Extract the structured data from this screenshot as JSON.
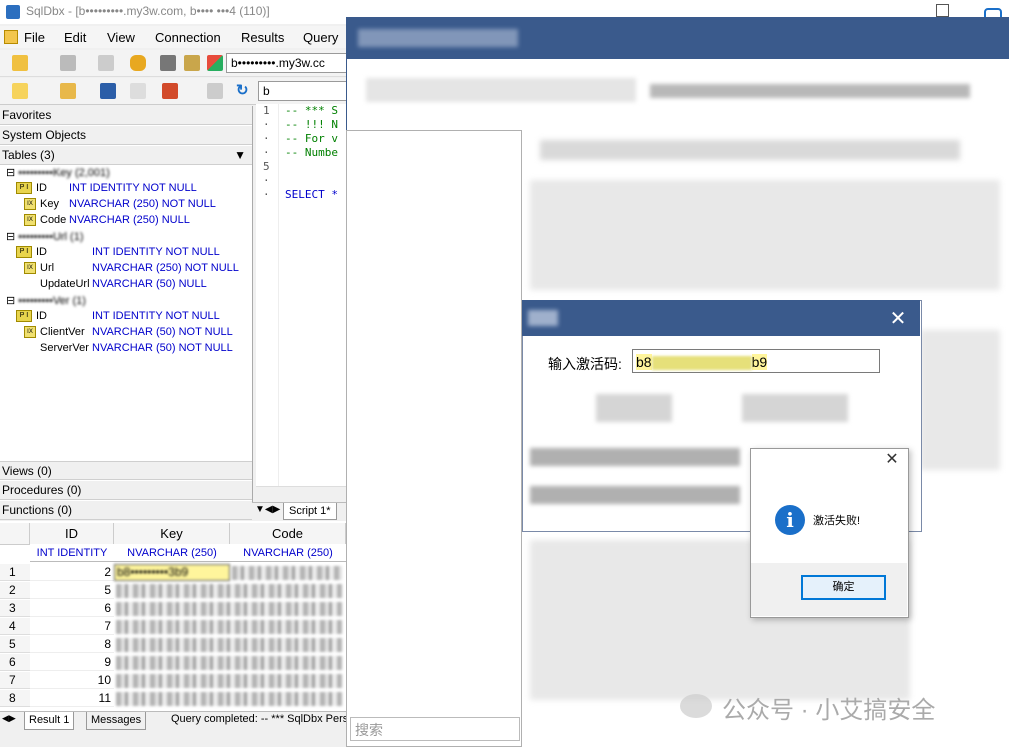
{
  "window": {
    "title": "SqlDbx - [b•••••••••.my3w.com, b•••• •••4 (110)]"
  },
  "menu": {
    "items": [
      "File",
      "Edit",
      "View",
      "Connection",
      "Results",
      "Query"
    ]
  },
  "toolbar": {
    "server_combo": "b•••••••••.my3w.cc",
    "db_combo": "b"
  },
  "tree": {
    "favorites": "Favorites",
    "system_objects": "System Objects",
    "tables_header": "Tables  (3)",
    "tables": [
      {
        "name": "•••••••••Key  (2,001)",
        "columns": [
          {
            "name": "ID",
            "type": "INT IDENTITY NOT NULL",
            "pk": true
          },
          {
            "name": "Key",
            "type": "NVARCHAR (250) NOT NULL"
          },
          {
            "name": "Code",
            "type": "NVARCHAR (250) NULL"
          }
        ]
      },
      {
        "name": "•••••••••Url  (1)",
        "columns": [
          {
            "name": "ID",
            "type": "INT IDENTITY NOT NULL",
            "pk": true
          },
          {
            "name": "Url",
            "type": "NVARCHAR (250) NOT NULL"
          },
          {
            "name": "UpdateUrl",
            "type": "NVARCHAR (50) NULL"
          }
        ]
      },
      {
        "name": "•••••••••Ver  (1)",
        "columns": [
          {
            "name": "ID",
            "type": "INT IDENTITY NOT NULL",
            "pk": true
          },
          {
            "name": "ClientVer",
            "type": "NVARCHAR (50) NOT NULL"
          },
          {
            "name": "ServerVer",
            "type": "NVARCHAR (50) NOT NULL"
          }
        ]
      }
    ],
    "views": "Views  (0)",
    "procedures": "Procedures  (0)",
    "functions": "Functions  (0)"
  },
  "editor": {
    "lines": [
      "1",
      "·",
      "·",
      "·",
      "5",
      "·",
      "·"
    ],
    "code": [
      "-- *** S",
      "-- !!! N",
      "-- For v",
      "-- Numbe",
      "",
      "",
      "SELECT *"
    ],
    "tab": "Script 1*"
  },
  "grid": {
    "headers": [
      "ID",
      "Key",
      "Code"
    ],
    "types": [
      "INT IDENTITY",
      "NVARCHAR (250)",
      "NVARCHAR (250)"
    ],
    "rows": [
      {
        "n": "1",
        "id": "2",
        "key": "b8•••••••••3b9"
      },
      {
        "n": "2",
        "id": "5",
        "key": ""
      },
      {
        "n": "3",
        "id": "6",
        "key": ""
      },
      {
        "n": "4",
        "id": "7",
        "key": ""
      },
      {
        "n": "5",
        "id": "8",
        "key": ""
      },
      {
        "n": "6",
        "id": "9",
        "key": ""
      },
      {
        "n": "7",
        "id": "10",
        "key": ""
      },
      {
        "n": "8",
        "id": "11",
        "key": ""
      }
    ]
  },
  "status": {
    "tab_result": "Result 1",
    "tab_messages": "Messages",
    "text": "Query completed: -- *** SqlDbx Pers"
  },
  "activation": {
    "label": "输入激活码:",
    "code_prefix": "b8",
    "code_suffix": "b9",
    "close": "✕"
  },
  "msgbox": {
    "icon": "i",
    "text": "激活失败!",
    "ok": "确定",
    "close": "✕"
  },
  "bgapp": {
    "search_placeholder": "搜索"
  },
  "watermark": "公众号 · 小艾搞安全"
}
